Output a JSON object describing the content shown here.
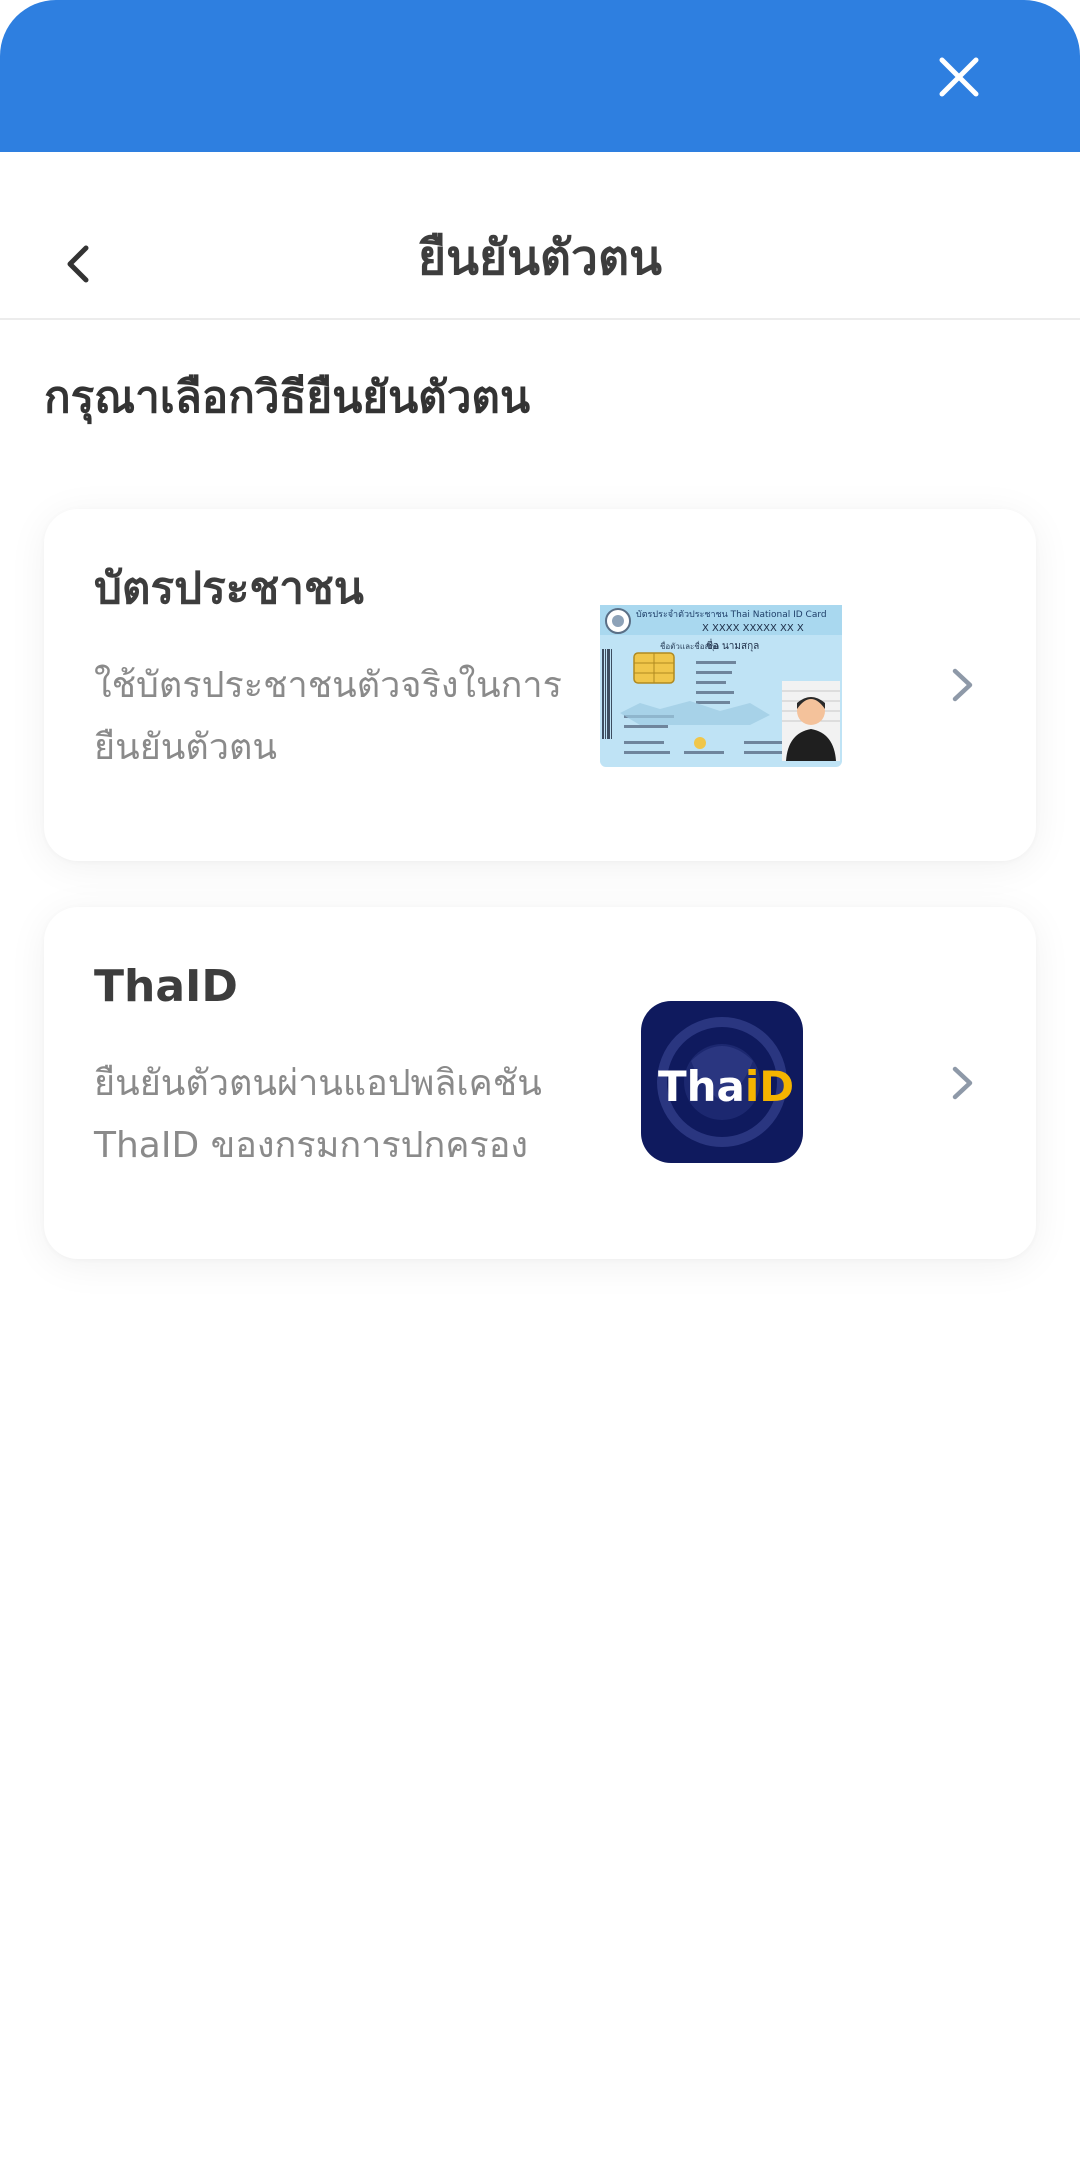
{
  "header": {
    "title": "ยืนยันตัวตน",
    "close_icon": "close-icon",
    "back_icon": "chevron-left-icon"
  },
  "main": {
    "heading": "กรุณาเลือกวิธียืนยันตัวตน",
    "methods": [
      {
        "title": "บัตรประชาชน",
        "description": [
          "ใช้บัตรประชาชนตัวจริงในการ",
          "ยืนยันตัวตน"
        ],
        "image_icon": "thai-national-id-card-image",
        "card_text": {
          "header": "บัตรประจำตัวประชาชน Thai National ID Card",
          "number": "X XXXX XXXXX XX X",
          "name": "ชื่อ นามสกุล"
        }
      },
      {
        "title": "ThaID",
        "description": [
          "ยืนยันตัวตนผ่านแอปพลิเคชัน",
          "ThaID ของกรมการปกครอง"
        ],
        "image_icon": "thaid-app-logo",
        "logo_text": {
          "part1": "Tha",
          "part2": "iD"
        }
      }
    ]
  },
  "colors": {
    "top_bar": "#2e7fe0",
    "title": "#3d3d3d",
    "description": "#8a8a8a",
    "chevron": "#8e99a8",
    "thaid_bg": "#0f1a5e",
    "thaid_accent": "#f4b400"
  }
}
